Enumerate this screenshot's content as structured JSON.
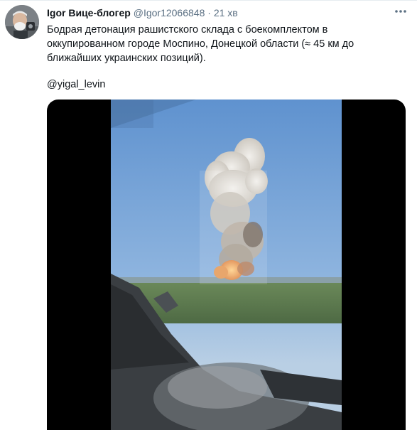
{
  "tweet": {
    "display_name": "Igor Вице-блогер",
    "handle": "@Igor12066848",
    "separator": "·",
    "time": "21 хв",
    "text": "Бодрая детонация рашистского склада с боекомплектом в оккупированном городе Моспино, Донецкой области (≈ 45 км до ближайших украинских позиций).",
    "mention": "@yigal_levin"
  },
  "icons": {
    "more": "more-horizontal-icon",
    "avatar": "avatar"
  },
  "colors": {
    "text": "#0f1419",
    "secondary": "#5b7083",
    "media_background": "#000000"
  }
}
